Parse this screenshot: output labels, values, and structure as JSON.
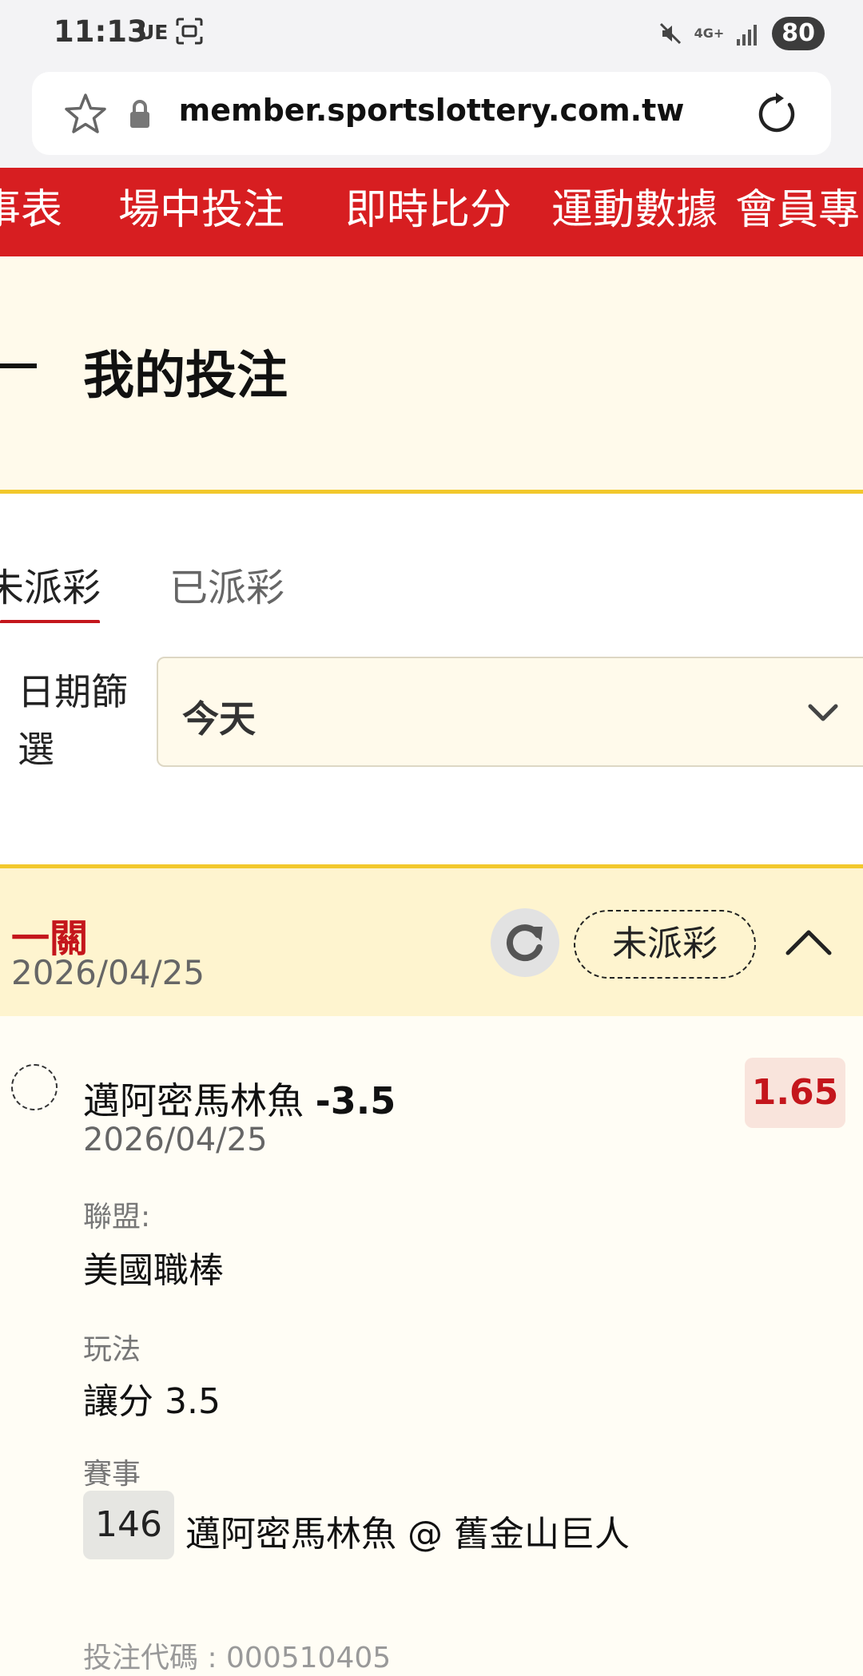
{
  "status_bar": {
    "time": "11:13",
    "carrier": "UE",
    "network": "4G+",
    "battery": "80"
  },
  "browser": {
    "url": "member.sportslottery.com.tw"
  },
  "nav": {
    "items": [
      "事表",
      "場中投注",
      "即時比分",
      "運動數據",
      "會員專"
    ]
  },
  "header": {
    "title": "我的投注"
  },
  "tabs": {
    "unpaid": "未派彩",
    "paid": "已派彩"
  },
  "filter": {
    "label": "日期篩選",
    "value": "今天"
  },
  "group": {
    "title": "一關",
    "date": "2026/04/25",
    "status": "未派彩"
  },
  "bet": {
    "team": "邁阿密馬林魚",
    "line": "-3.5",
    "odds": "1.65",
    "date": "2026/04/25",
    "league_label": "聯盟:",
    "league": "美國職棒",
    "play_label": "玩法",
    "play": "讓分 3.5",
    "match_label": "賽事",
    "match_no": "146",
    "match": "邁阿密馬林魚 @ 舊金山巨人",
    "code_partial": "投注代碼 : 000510405"
  },
  "colors": {
    "brand_red": "#d71e21",
    "accent_yellow": "#f2c82b"
  }
}
